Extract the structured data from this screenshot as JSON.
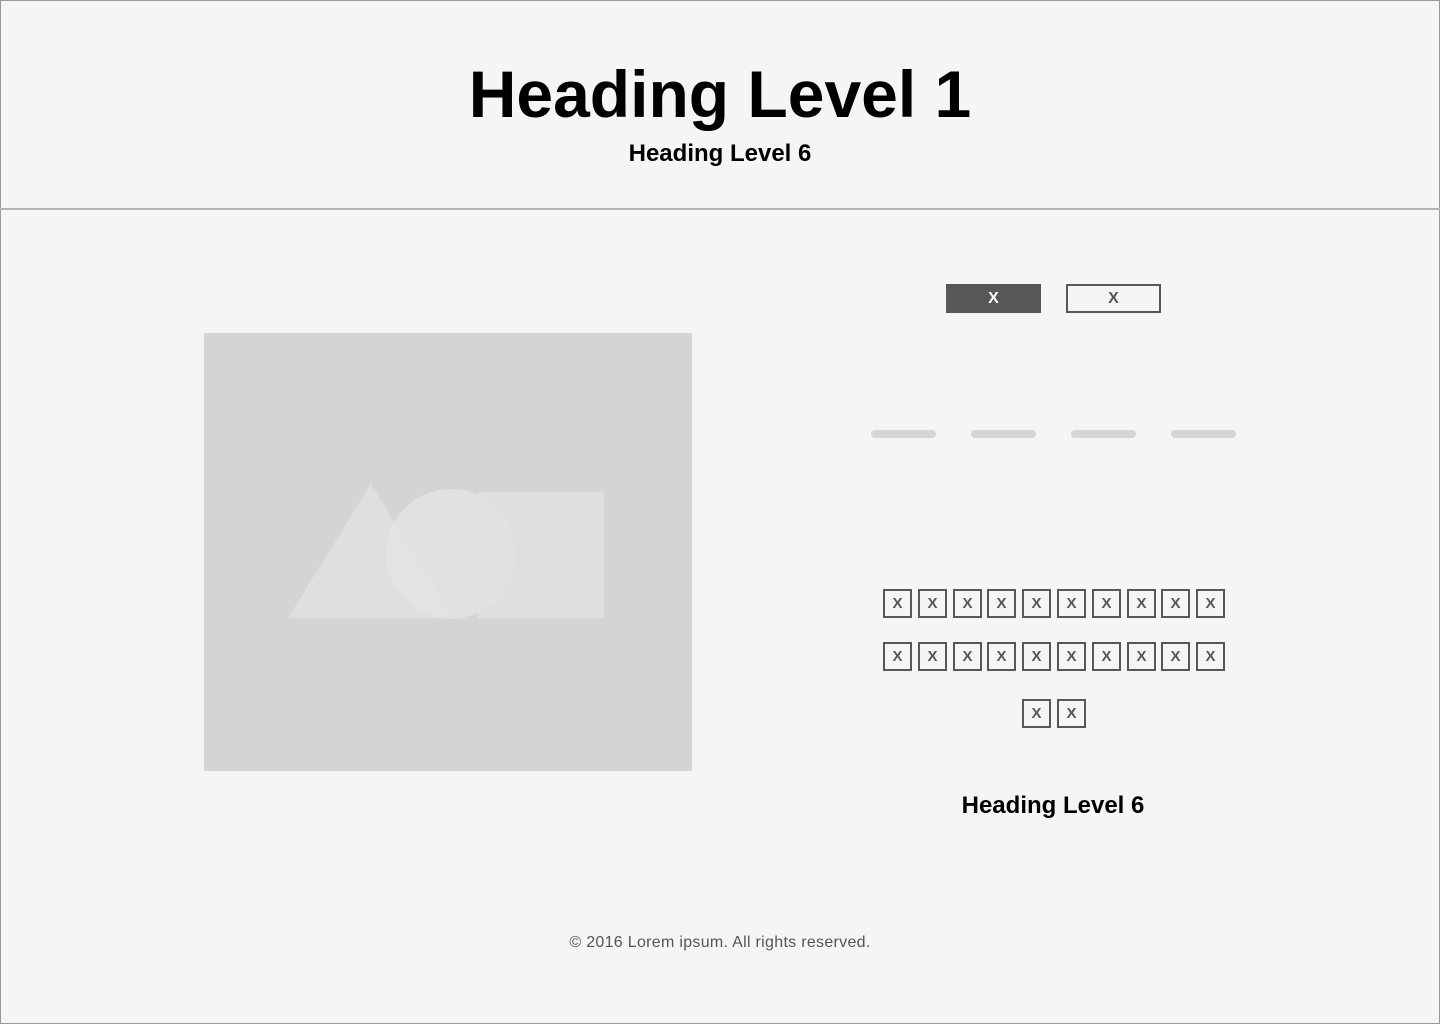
{
  "header": {
    "title": "Heading Level 1",
    "subtitle": "Heading Level 6"
  },
  "media": {
    "image_icon": "image-placeholder-icon"
  },
  "toggle": {
    "active_label": "X",
    "inactive_label": "X"
  },
  "chips": {
    "row1": [
      "X",
      "X",
      "X",
      "X",
      "X",
      "X",
      "X",
      "X",
      "X",
      "X"
    ],
    "row2": [
      "X",
      "X",
      "X",
      "X",
      "X",
      "X",
      "X",
      "X",
      "X",
      "X"
    ],
    "row3": [
      "X",
      "X"
    ]
  },
  "section": {
    "heading": "Heading Level 6"
  },
  "footer": {
    "copyright": "© 2016 Lorem ipsum. All rights reserved."
  },
  "colors": {
    "background": "#f5f5f5",
    "active_button": "#575757",
    "placeholder": "#d4d4d4",
    "bar": "#d6d6d6"
  }
}
